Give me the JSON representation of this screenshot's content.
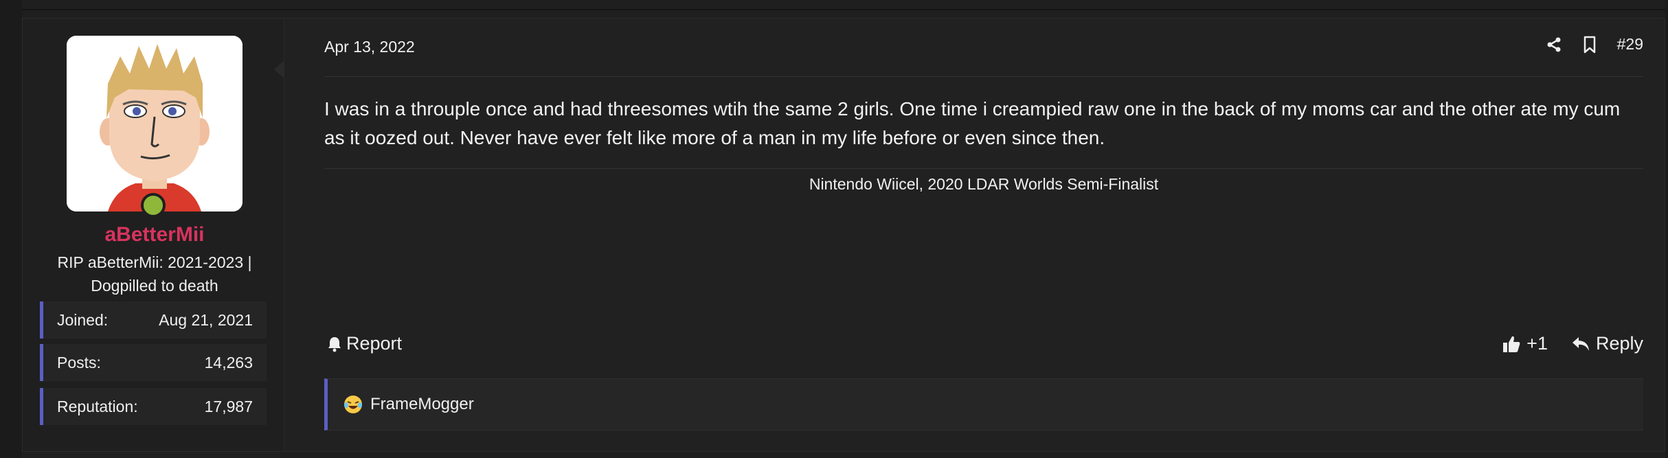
{
  "user": {
    "username": "aBetterMii",
    "title": "RIP aBetterMii: 2021-2023 | Dogpilled to death",
    "stats": [
      {
        "label": "Joined:",
        "value": "Aug 21, 2021"
      },
      {
        "label": "Posts:",
        "value": "14,263"
      },
      {
        "label": "Reputation:",
        "value": "17,987"
      }
    ]
  },
  "post": {
    "date": "Apr 13, 2022",
    "number": "#29",
    "body": "I was in a throuple once and had threesomes wtih the same 2 girls. One time i creampied raw one in the back of my moms car and the other ate my cum as it oozed out. Never have ever felt like more of a man in my life before or even since then.",
    "signature": "Nintendo Wiicel, 2020 LDAR Worlds Semi-Finalist"
  },
  "actions": {
    "report_label": "Report",
    "plus_one_label": "+1",
    "reply_label": "Reply"
  },
  "reactions": {
    "reactor": "FrameMogger"
  },
  "colors": {
    "username": "#d8335e",
    "accent_bar": "#5a5fc4",
    "online": "#8fb83b"
  },
  "icons": [
    "share-icon",
    "bookmark-icon",
    "bell-icon",
    "thumbs-up-icon",
    "reply-icon",
    "laughing-emoji-icon"
  ]
}
